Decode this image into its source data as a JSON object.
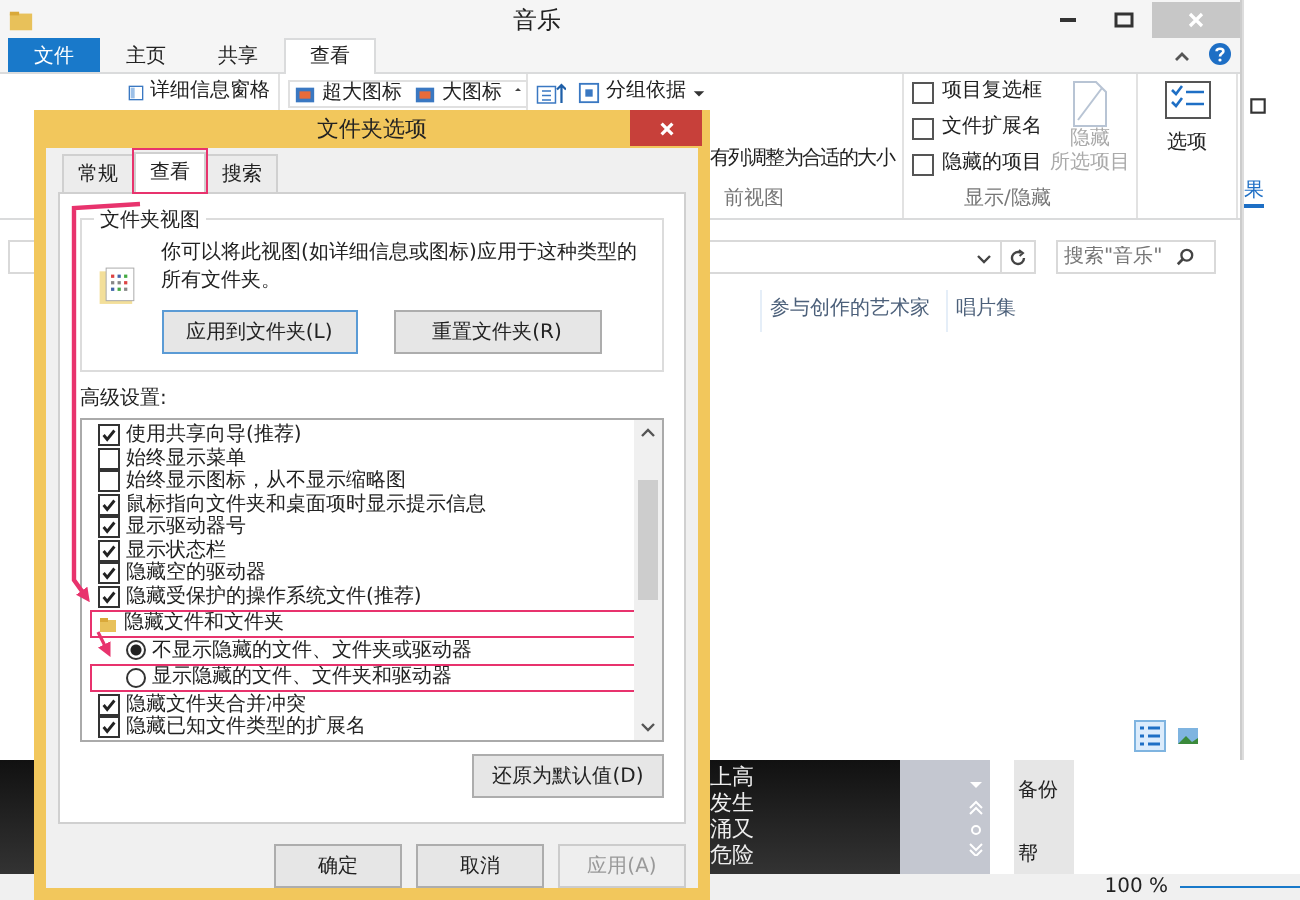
{
  "window": {
    "title": "音乐"
  },
  "ribbon": {
    "tabs": [
      {
        "label": "文件",
        "kind": "file",
        "selected": false
      },
      {
        "label": "主页",
        "kind": "tab",
        "selected": false
      },
      {
        "label": "共享",
        "kind": "tab",
        "selected": false
      },
      {
        "label": "查看",
        "kind": "tab",
        "selected": true
      }
    ],
    "pane_commands": [
      "详细信息窗格"
    ],
    "layout_items": [
      "超大图标",
      "大图标"
    ],
    "view_commands": [
      {
        "label": "分组依据",
        "kind": "dropdown"
      },
      {
        "label": "有列调整为合适的大小",
        "kind": "plain"
      }
    ],
    "view_group_label": "前视图",
    "show_hide": {
      "checkboxes": [
        {
          "label": "项目复选框",
          "checked": false
        },
        {
          "label": "文件扩展名",
          "checked": false
        },
        {
          "label": "隐藏的项目",
          "checked": false
        }
      ],
      "hide_button": {
        "lines": [
          "隐藏",
          "所选项目"
        ],
        "disabled": true
      },
      "group_label": "显示/隐藏"
    },
    "options_button": "选项"
  },
  "search": {
    "placeholder": "搜索\"音乐\""
  },
  "columns": [
    "参与创作的艺术家",
    "唱片集"
  ],
  "side_window": {
    "tab": "果"
  },
  "background_app": {
    "lines": [
      "上高",
      "发生",
      "涌又",
      "危险"
    ],
    "panel": [
      "备份",
      "帮"
    ],
    "zoom": "100 %"
  },
  "dialog": {
    "title": "文件夹选项",
    "tabs": [
      {
        "label": "常规",
        "selected": false
      },
      {
        "label": "查看",
        "selected": true,
        "highlighted": true
      },
      {
        "label": "搜索",
        "selected": false
      }
    ],
    "folder_views": {
      "title": "文件夹视图",
      "text": "你可以将此视图(如详细信息或图标)应用于这种类型的所有文件夹。",
      "buttons": [
        "应用到文件夹(L)",
        "重置文件夹(R)"
      ]
    },
    "advanced_label": "高级设置:",
    "settings": [
      {
        "kind": "checkbox",
        "label": "使用共享向导(推荐)",
        "checked": true
      },
      {
        "kind": "checkbox",
        "label": "始终显示菜单",
        "checked": false
      },
      {
        "kind": "checkbox",
        "label": "始终显示图标，从不显示缩略图",
        "checked": false
      },
      {
        "kind": "checkbox",
        "label": "鼠标指向文件夹和桌面项时显示提示信息",
        "checked": true
      },
      {
        "kind": "checkbox",
        "label": "显示驱动器号",
        "checked": true
      },
      {
        "kind": "checkbox",
        "label": "显示状态栏",
        "checked": true
      },
      {
        "kind": "checkbox",
        "label": "隐藏空的驱动器",
        "checked": true
      },
      {
        "kind": "checkbox",
        "label": "隐藏受保护的操作系统文件(推荐)",
        "checked": true
      },
      {
        "kind": "folder",
        "label": "隐藏文件和文件夹",
        "highlighted": true
      },
      {
        "kind": "radio",
        "label": "不显示隐藏的文件、文件夹或驱动器",
        "selected": true
      },
      {
        "kind": "radio",
        "label": "显示隐藏的文件、文件夹和驱动器",
        "selected": false,
        "highlighted": true
      },
      {
        "kind": "checkbox",
        "label": "隐藏文件夹合并冲突",
        "checked": true
      },
      {
        "kind": "checkbox",
        "label": "隐藏已知文件类型的扩展名",
        "checked": true
      }
    ],
    "restore_button": "还原为默认值(D)",
    "buttons": [
      {
        "label": "确定",
        "disabled": false
      },
      {
        "label": "取消",
        "disabled": false
      },
      {
        "label": "应用(A)",
        "disabled": true
      }
    ]
  }
}
